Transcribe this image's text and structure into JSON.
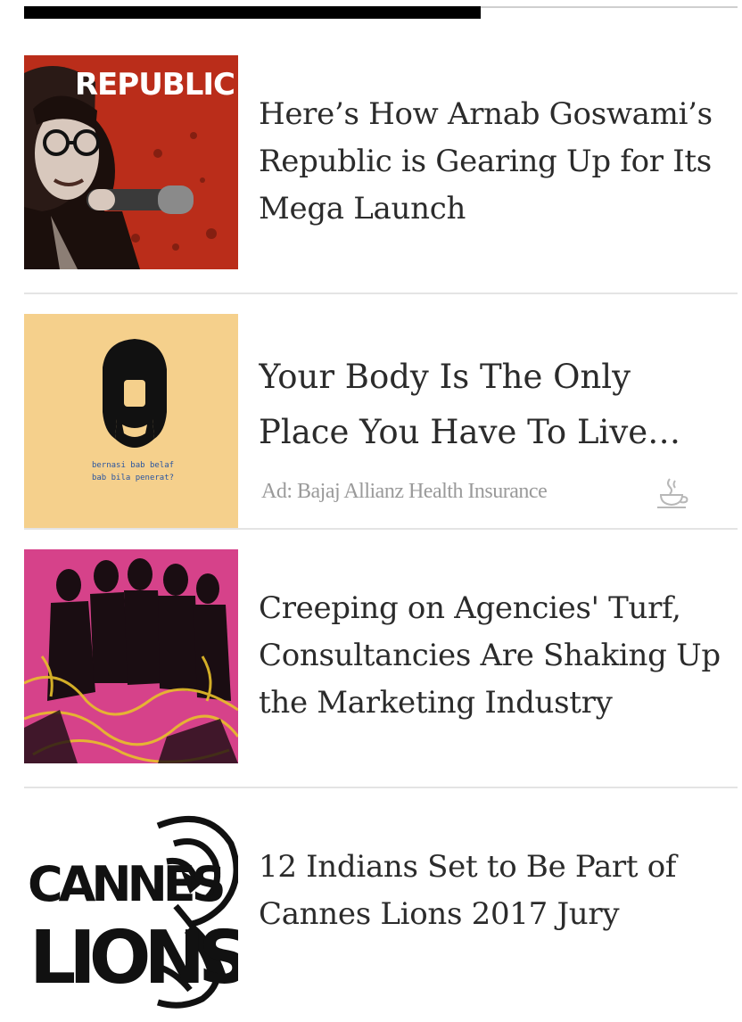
{
  "progress": {
    "fraction": 0.64
  },
  "stories": [
    {
      "thumb_label": "REPUBLIC",
      "headline": "Here’s How Arnab Goswami’s Republic is Gearing Up for Its Mega Launch"
    },
    {
      "thumb_caption_line1": "bernasi bab belaf",
      "thumb_caption_line2": "bab bila penerat?",
      "headline_line1": "Your Body Is The Only",
      "headline_line2": "Place You Have To Live…",
      "ad_source": "Ad: Bajaj Allianz Health Insurance",
      "ad_icon": "teacup-icon"
    },
    {
      "headline": "Creeping on Agencies' Turf, Consultancies Are Shaking Up the Marketing Industry"
    },
    {
      "thumb_label_line1": "CANNES",
      "thumb_label_line2": "LIONS",
      "headline": "12 Indians Set to Be Part of Cannes Lions 2017 Jury"
    }
  ],
  "colors": {
    "republic_red": "#c4321e",
    "ad_bg": "#f5d08c",
    "agencies_pink": "#d6428a",
    "divider": "#e4e4e4",
    "progress": "#000000"
  }
}
